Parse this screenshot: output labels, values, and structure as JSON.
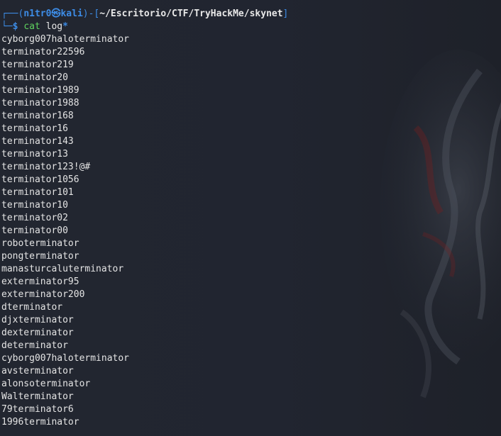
{
  "prompt": {
    "corner_top": "┌──(",
    "user": "n1tr0",
    "at_symbol": "㉿",
    "host": "kali",
    "sep": ")-[",
    "path": "~/Escritorio/CTF/TryHackMe/skynet",
    "close": "]",
    "corner_bottom": "└─",
    "dollar": "$",
    "command": "cat",
    "argument": "log",
    "glob": "*"
  },
  "output": [
    "cyborg007haloterminator",
    "terminator22596",
    "terminator219",
    "terminator20",
    "terminator1989",
    "terminator1988",
    "terminator168",
    "terminator16",
    "terminator143",
    "terminator13",
    "terminator123!@#",
    "terminator1056",
    "terminator101",
    "terminator10",
    "terminator02",
    "terminator00",
    "roboterminator",
    "pongterminator",
    "manasturcaluterminator",
    "exterminator95",
    "exterminator200",
    "dterminator",
    "djxterminator",
    "dexterminator",
    "determinator",
    "cyborg007haloterminator",
    "avsterminator",
    "alonsoterminator",
    "Walterminator",
    "79terminator6",
    "1996terminator"
  ],
  "colors": {
    "background": "#20242d",
    "prompt_blue": "#3d8ce6",
    "command_green": "#5fd35f",
    "text": "#e4e4e4"
  }
}
